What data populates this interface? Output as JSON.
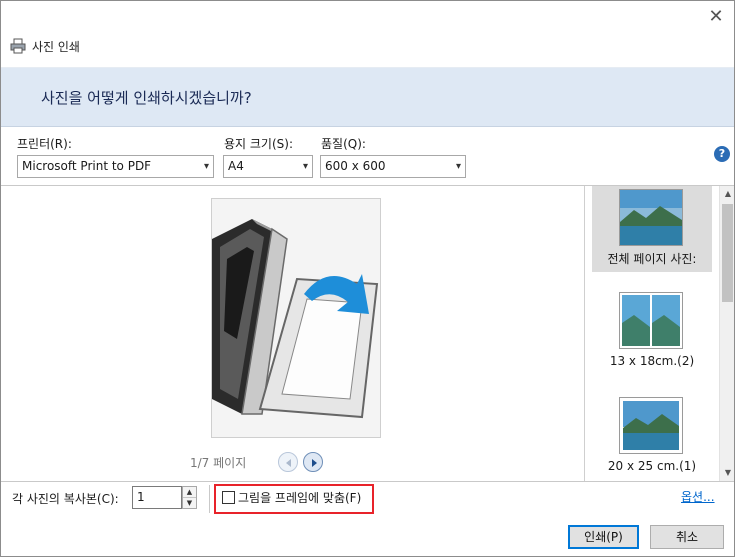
{
  "window": {
    "title": "사진 인쇄"
  },
  "banner": {
    "heading": "사진을 어떻게 인쇄하시겠습니까?"
  },
  "settings": {
    "printer_label": "프린터(R):",
    "printer_value": "Microsoft Print to PDF",
    "paper_size_label": "용지 크기(S):",
    "paper_size_value": "A4",
    "quality_label": "품질(Q):",
    "quality_value": "600 x 600"
  },
  "preview": {
    "page_indicator": "1/7 페이지"
  },
  "layouts": [
    {
      "label": "전체 페이지 사진:",
      "selected": true
    },
    {
      "label": "13 x 18cm.(2)",
      "selected": false
    },
    {
      "label": "20 x 25 cm.(1)",
      "selected": false
    }
  ],
  "bottom": {
    "copies_label": "각 사진의 복사본(C):",
    "copies_value": "1",
    "fit_label": "그림을 프레임에 맞춤(F)",
    "fit_checked": false,
    "options_link": "옵션..."
  },
  "buttons": {
    "print": "인쇄(P)",
    "cancel": "취소"
  },
  "icons": {
    "close": "close-icon",
    "app": "printer-icon",
    "help": "help-icon",
    "prev": "chevron-left-icon",
    "next": "chevron-right-icon"
  },
  "colors": {
    "accent": "#0078d7",
    "banner": "#dee8f4",
    "highlight_box": "#e8232a",
    "link": "#0066cc"
  }
}
